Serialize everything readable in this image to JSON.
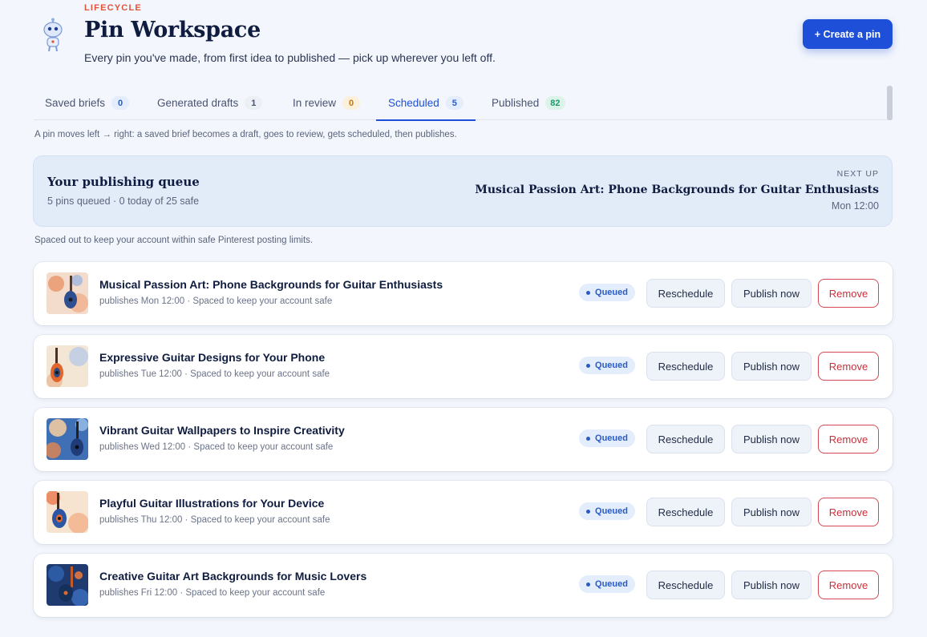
{
  "header": {
    "eyebrow": "LIFECYCLE",
    "title": "Pin Workspace",
    "subtitle": "Every pin you've made, from first idea to published — pick up wherever you left off.",
    "create_label": "+ Create a pin"
  },
  "tabs": [
    {
      "label": "Saved briefs",
      "count": "0",
      "active": false,
      "color": "#2a5bc4",
      "bg": "#e3edfb"
    },
    {
      "label": "Generated drafts",
      "count": "1",
      "active": false,
      "color": "#4a5470",
      "bg": "#eceff4"
    },
    {
      "label": "In review",
      "count": "0",
      "active": false,
      "color": "#c07a10",
      "bg": "#fbf0dc"
    },
    {
      "label": "Scheduled",
      "count": "5",
      "active": true,
      "color": "#2a5bc4",
      "bg": "#e3edfb"
    },
    {
      "label": "Published",
      "count": "82",
      "active": false,
      "color": "#1b9a6e",
      "bg": "#dcf3ea"
    }
  ],
  "hint": "A pin moves left → right: a saved brief becomes a draft, goes to review, gets scheduled, then publishes.",
  "queue": {
    "title": "Your publishing queue",
    "stats": "5 pins queued · 0 today of 25 safe",
    "next_label": "NEXT UP",
    "next_title": "Musical Passion Art: Phone Backgrounds for Guitar Enthusiasts",
    "next_time": "Mon 12:00"
  },
  "spacing_note": "Spaced out to keep your account within safe Pinterest posting limits.",
  "pins": [
    {
      "title": "Musical Passion Art: Phone Backgrounds for Guitar Enthusiasts",
      "meta": "publishes Mon 12:00 · Spaced to keep your account safe",
      "status": "Queued",
      "reschedule": "Reschedule",
      "publish": "Publish now",
      "remove": "Remove"
    },
    {
      "title": "Expressive Guitar Designs for Your Phone",
      "meta": "publishes Tue 12:00 · Spaced to keep your account safe",
      "status": "Queued",
      "reschedule": "Reschedule",
      "publish": "Publish now",
      "remove": "Remove"
    },
    {
      "title": "Vibrant Guitar Wallpapers to Inspire Creativity",
      "meta": "publishes Wed 12:00 · Spaced to keep your account safe",
      "status": "Queued",
      "reschedule": "Reschedule",
      "publish": "Publish now",
      "remove": "Remove"
    },
    {
      "title": "Playful Guitar Illustrations for Your Device",
      "meta": "publishes Thu 12:00 · Spaced to keep your account safe",
      "status": "Queued",
      "reschedule": "Reschedule",
      "publish": "Publish now",
      "remove": "Remove"
    },
    {
      "title": "Creative Guitar Art Backgrounds for Music Lovers",
      "meta": "publishes Fri 12:00 · Spaced to keep your account safe",
      "status": "Queued",
      "reschedule": "Reschedule",
      "publish": "Publish now",
      "remove": "Remove"
    }
  ],
  "colors": {
    "accent": "#1d4fd8",
    "eyebrow": "#e0533b",
    "danger": "#c8313b"
  }
}
